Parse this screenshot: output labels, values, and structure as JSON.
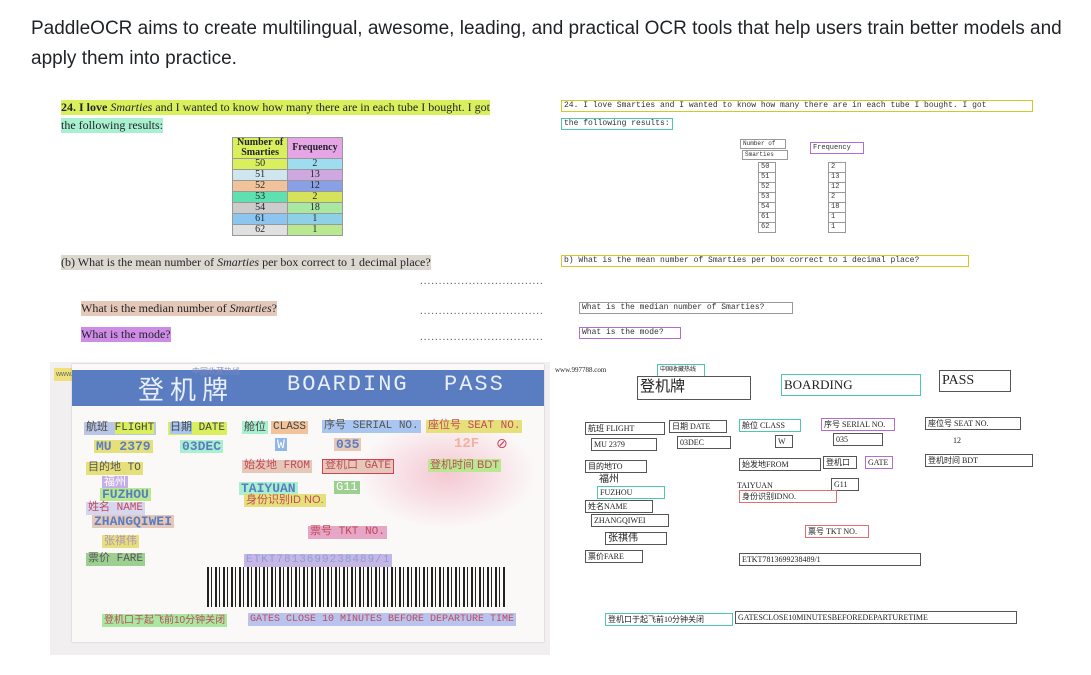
{
  "intro": "PaddleOCR aims to create multilingual, awesome, leading, and practical OCR tools that help users train better models and apply them into practice.",
  "worksheet": {
    "q_line1_prefix": "24.  I love ",
    "q_line1_em": "Smarties",
    "q_line1_rest": " and I wanted to know how many there are in each tube I bought. I got",
    "q_line2": "the following results:",
    "col1_line1": "Number of",
    "col1_line2": "Smarties",
    "col2": "Frequency",
    "rows": [
      {
        "n": "50",
        "f": "2"
      },
      {
        "n": "51",
        "f": "13"
      },
      {
        "n": "52",
        "f": "12"
      },
      {
        "n": "53",
        "f": "2"
      },
      {
        "n": "54",
        "f": "18"
      },
      {
        "n": "61",
        "f": "1"
      },
      {
        "n": "62",
        "f": "1"
      }
    ],
    "qb_prefix": "(b)  What is the mean number of ",
    "qb_em": "Smarties",
    "qb_rest": " per box correct to 1 decimal place?",
    "qc_prefix": "What is the median number of ",
    "qc_em": "Smarties",
    "qc_rest": "?",
    "qd": "What is the mode?",
    "dots": ".................................",
    "r_q1": "24.  I love Smarties and I wanted to know how many there are in each tube I bought.  I got",
    "r_q2": "the following results:",
    "r_col1a": "Number of",
    "r_col1b": "Smarties",
    "r_col2": "Frequency",
    "r_qb": "b) What is the mean number of Smarties per box correct to 1 decimal place?",
    "r_qc": "What is the median number of Smarties?",
    "r_qd": "What is the mode?"
  },
  "boarding": {
    "watermark": "www.997788.com",
    "watermark2": "中国收藏热线",
    "title_cn": "登机牌",
    "title_en1": "BOARDING",
    "title_en2": "PASS",
    "flight_cn": "航班",
    "flight_en": "FLIGHT",
    "flight_val": "MU 2379",
    "date_cn": "日期",
    "date_en": "DATE",
    "date_val": "03DEC",
    "class_cn": "舱位",
    "class_en": "CLASS",
    "class_val": "W",
    "serial_cn": "序号",
    "serial_en": "SERIAL NO.",
    "serial_val": "035",
    "seat_cn": "座位号",
    "seat_en": "SEAT NO.",
    "seat_val": "12F",
    "seat_val_r": "12",
    "to_label": "目的地  TO",
    "to_cn": "福州",
    "to_val": "FUZHOU",
    "from_label": "始发地  FROM",
    "from_val": "TAIYUAN",
    "gate_cn": "登机口",
    "gate_en": "GATE",
    "gate_val": "G11",
    "bdt_label": "登机时间 BDT",
    "idno": "身份识别ID NO.",
    "name_label": "姓名  NAME",
    "name_val": "ZHANGQIWEI",
    "name_cn": "张祺伟",
    "tkt": "票号 TKT NO.",
    "fare": "票价 FARE",
    "etkt": "ETKT7813699238489/1",
    "footer_cn": "登机口于起飞前10分钟关闭",
    "footer_en": "GATES CLOSE 10 MINUTES BEFORE DEPARTURE TIME",
    "r_footer_en": "GATESCLOSE10MINUTESBEFOREDEPARTURETIME",
    "r_from": "始发地FROM",
    "r_flight": "航班  FLIGHT",
    "r_date": "日期  DATE",
    "r_class": "舱位  CLASS",
    "r_serial": "序号  SERIAL NO.",
    "r_seat": "座位号  SEAT NO.",
    "r_gate": "登机口  GATE",
    "r_fare": "票价FARE",
    "r_name": "姓名NAME",
    "r_to": "目的地TO",
    "r_id": "身份识别IDNO."
  },
  "colors": {
    "header_blue": "#5a7dc2",
    "highlight_yellow": "#d9ef5b",
    "highlight_cyan": "#a8f0d0"
  }
}
